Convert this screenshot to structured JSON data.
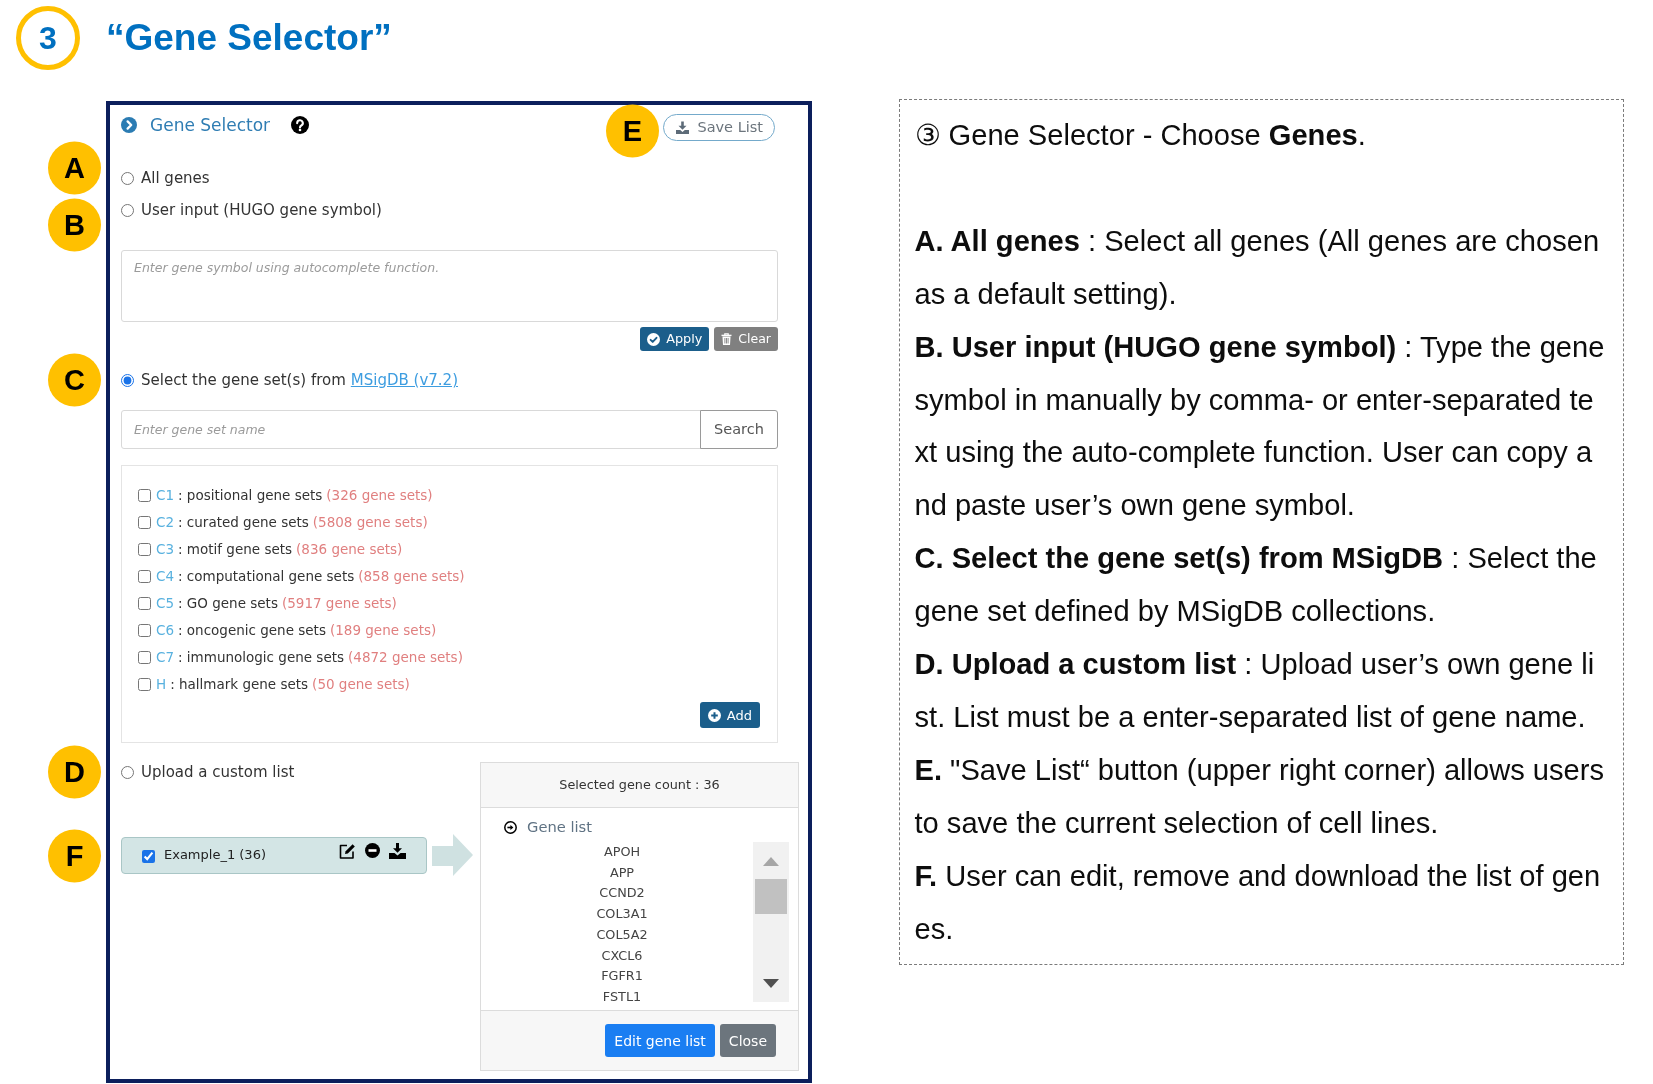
{
  "step": {
    "number": "3",
    "title": "“Gene Selector”"
  },
  "gene_selector": {
    "title": "Gene Selector",
    "save_button": {
      "label": "Save List",
      "callout": "E"
    },
    "options": [
      {
        "kind": "plain",
        "label": "All genes",
        "selected": false,
        "callout": "A"
      },
      {
        "kind": "symbol_input",
        "label": "User input (HUGO gene symbol)",
        "selected": false,
        "callout": "B",
        "input": {
          "placeholder": "Enter gene symbol using autocomplete function."
        },
        "buttons": [
          {
            "kind": "apply",
            "label": "Apply"
          },
          {
            "kind": "clear",
            "label": "Clear"
          }
        ]
      },
      {
        "kind": "msigdb",
        "label": "Select the gene set(s) from",
        "link": "MSigDB (v7.2)",
        "selected": true,
        "callout": "C",
        "search": {
          "placeholder": "Enter gene set name",
          "button": "Search"
        },
        "collections": [
          {
            "code": "C1",
            "name": ": positional gene sets",
            "count": "(326 gene sets)",
            "checked": false
          },
          {
            "code": "C2",
            "name": ": curated gene sets",
            "count": "(5808 gene sets)",
            "checked": false
          },
          {
            "code": "C3",
            "name": ": motif gene sets",
            "count": "(836 gene sets)",
            "checked": false
          },
          {
            "code": "C4",
            "name": ": computational gene sets",
            "count": "(858 gene sets)",
            "checked": false
          },
          {
            "code": "C5",
            "name": ": GO gene sets",
            "count": "(5917 gene sets)",
            "checked": false
          },
          {
            "code": "C6",
            "name": ": oncogenic gene sets",
            "count": "(189 gene sets)",
            "checked": false
          },
          {
            "code": "C7",
            "name": ": immunologic gene sets",
            "count": "(4872 gene sets)",
            "checked": false
          },
          {
            "code": "H",
            "name": ": hallmark gene sets",
            "count": "(50 gene sets)",
            "checked": false
          }
        ],
        "add_button": "Add"
      },
      {
        "kind": "upload",
        "label": "Upload a custom list",
        "selected": false,
        "callout": "D",
        "custom_lists": [
          {
            "name": "Example_1 (36)",
            "checked": true,
            "callout": "F"
          }
        ],
        "gene_panel": {
          "count_label": "Selected gene count : 36",
          "section_title": "Gene list",
          "genes": [
            "APOH",
            "APP",
            "CCND2",
            "COL3A1",
            "COL5A2",
            "CXCL6",
            "FGFR1",
            "FSTL1"
          ],
          "buttons": [
            {
              "kind": "primary",
              "label": "Edit gene list"
            },
            {
              "kind": "secondary",
              "label": "Close"
            }
          ]
        }
      }
    ]
  },
  "description": {
    "heading": "③ Gene Selector - Choose **Genes**.",
    "items": [
      "**A. All genes** : Select all genes (All genes are chosen as a default setting).",
      "**B. User input (HUGO gene symbol)** : Type the gene symbol in manually by comma- or enter-separated text using the auto-complete function. User can copy and paste user’s own gene symbol.",
      "**C. Select the gene set(s) from MSigDB** : Select the gene set defined by MSigDB collections.",
      "**D. Upload a custom list** : Upload user’s own gene list. List must be a enter-separated list of gene name.",
      "**E.** \"Save List“ button (upper right corner) allows users to save the current selection of cell lines.",
      "**F.** User can edit, remove and download the list of genes."
    ]
  }
}
